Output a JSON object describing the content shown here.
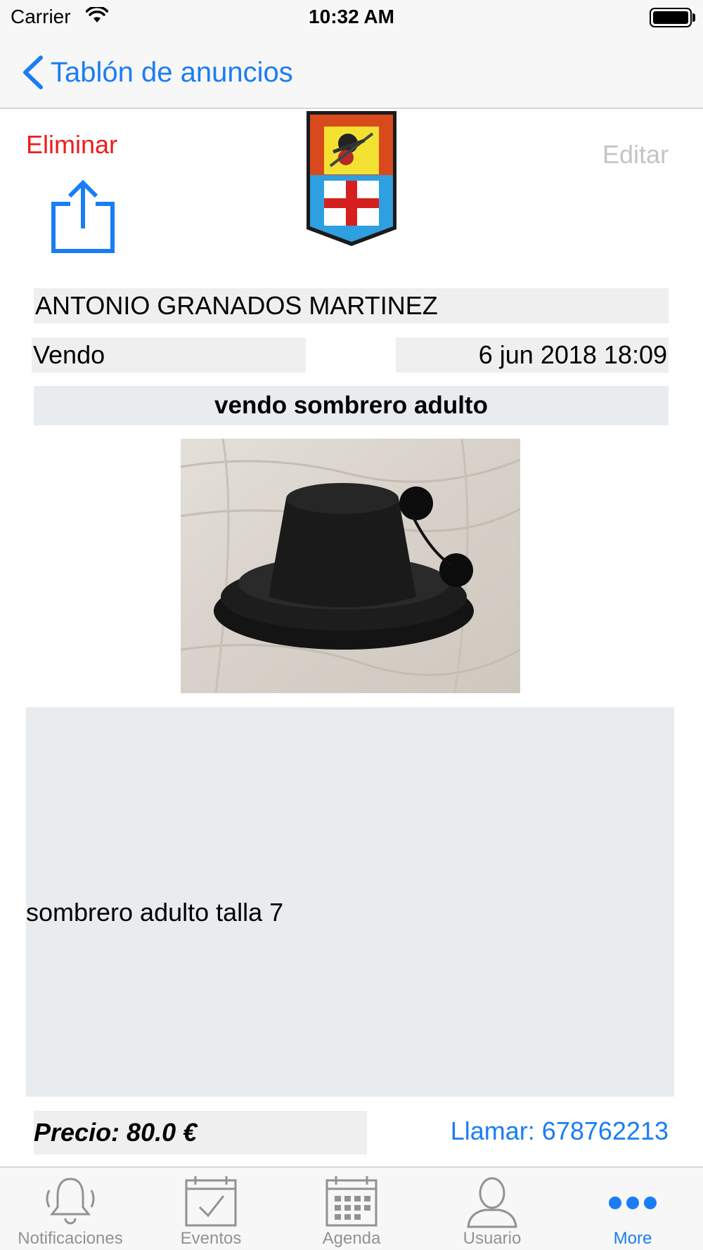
{
  "status_bar": {
    "carrier": "Carrier",
    "time": "10:32 AM",
    "wifi_icon": "wifi-icon",
    "battery_icon": "battery-icon"
  },
  "nav": {
    "back_label": "Tablón de anuncios",
    "back_icon": "chevron-left-icon"
  },
  "actions": {
    "delete_label": "Eliminar",
    "edit_label": "Editar",
    "share_icon": "share-icon"
  },
  "ad": {
    "author": "ANTONIO  GRANADOS MARTINEZ",
    "type": "Vendo",
    "date": "6 jun 2018 18:09",
    "title": "vendo sombrero adulto",
    "description": "sombrero adulto talla 7",
    "price": "Precio: 80.0 €",
    "call": "Llamar: 678762213"
  },
  "colors": {
    "accent": "#1a7df5",
    "delete": "#ee1c1c",
    "disabled": "#c4c4c6",
    "field_bg": "#efefef",
    "tab_inactive": "#929292"
  },
  "tabs": [
    {
      "label": "Notificaciones",
      "icon": "bell-icon",
      "active": false
    },
    {
      "label": "Eventos",
      "icon": "calendar-check-icon",
      "active": false
    },
    {
      "label": "Agenda",
      "icon": "calendar-grid-icon",
      "active": false
    },
    {
      "label": "Usuario",
      "icon": "user-icon",
      "active": false
    },
    {
      "label": "More",
      "icon": "more-icon",
      "active": true
    }
  ]
}
